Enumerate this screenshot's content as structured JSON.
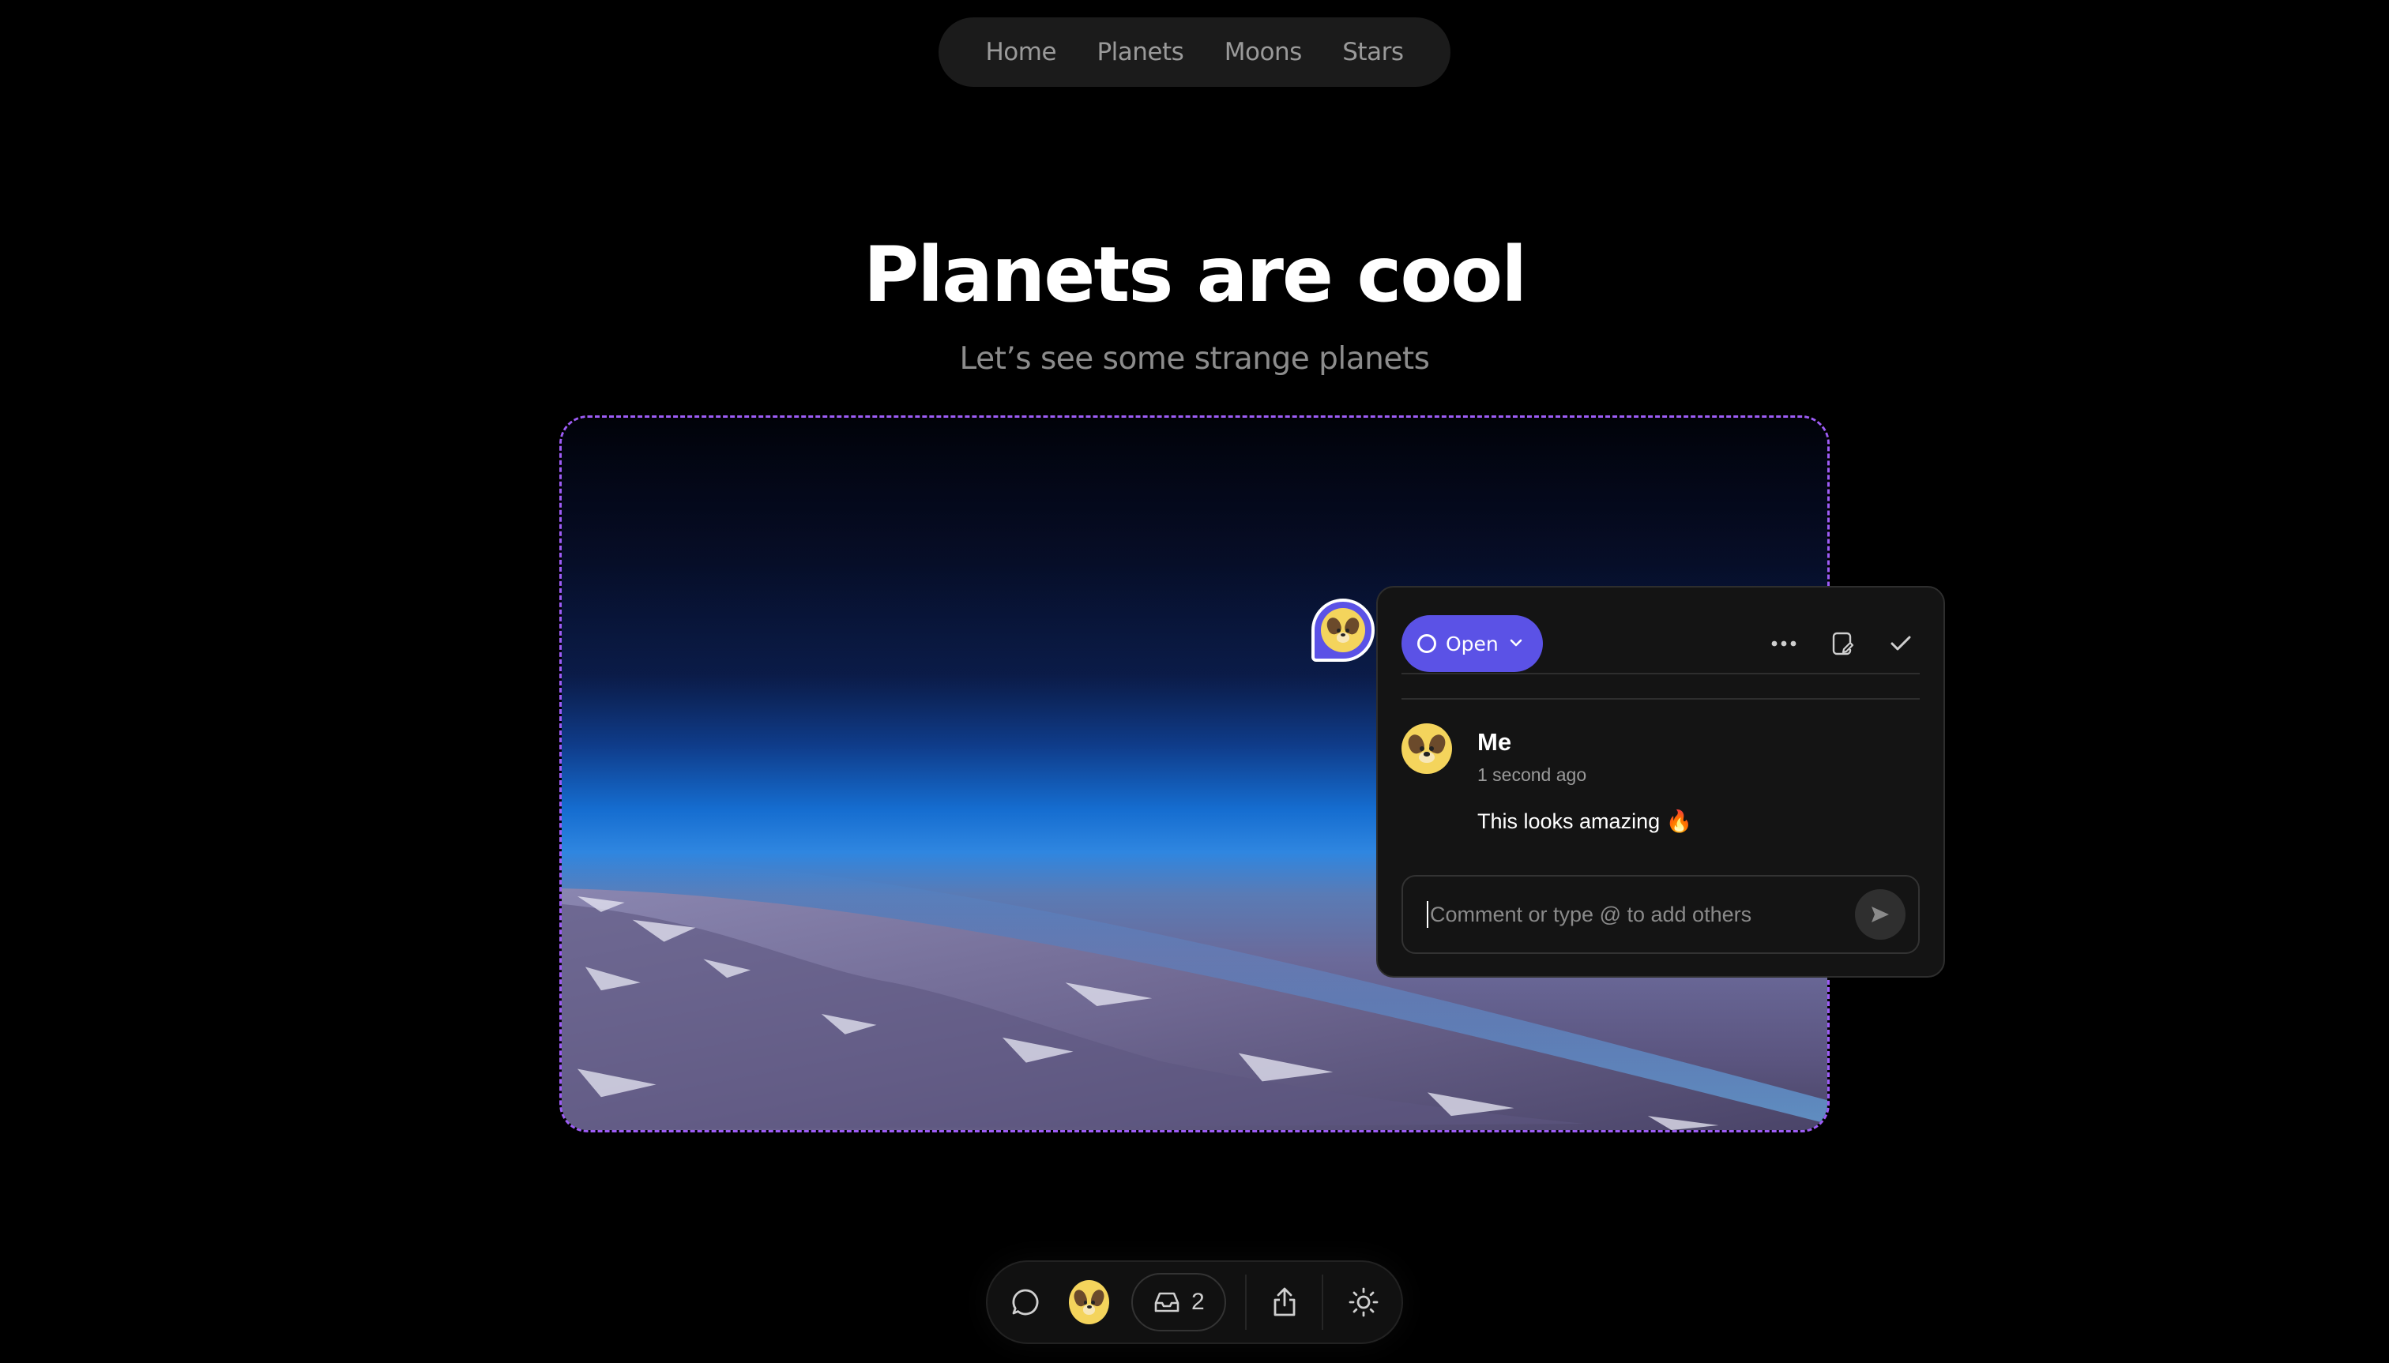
{
  "nav": {
    "items": [
      {
        "label": "Home"
      },
      {
        "label": "Planets"
      },
      {
        "label": "Moons"
      },
      {
        "label": "Stars"
      }
    ]
  },
  "hero": {
    "title": "Planets are cool",
    "subtitle": "Let’s see some strange planets"
  },
  "colors": {
    "accent": "#5b52e6",
    "selection_border": "#9d5cf5",
    "avatar": "#f4d45c",
    "background": "#000000",
    "panel": "#141414"
  },
  "comment_thread": {
    "status_label": "Open",
    "status_icon": "circle-icon",
    "status_chevron": "chevron-down-icon",
    "actions": [
      "more-options-icon",
      "mark-unread-icon",
      "resolve-check-icon"
    ],
    "comments": [
      {
        "author": "Me",
        "time": "1 second ago",
        "text": "This looks amazing 🔥",
        "avatar": "dog-avatar"
      }
    ],
    "input": {
      "value": "",
      "placeholder": "Comment or type @ to add others"
    },
    "send_icon": "send-icon"
  },
  "toolbar": {
    "comment_icon": "comment-bubble-icon",
    "avatar": "dog-avatar",
    "inbox_icon": "inbox-icon",
    "inbox_count": "2",
    "share_icon": "share-icon",
    "theme_icon": "sun-icon"
  }
}
